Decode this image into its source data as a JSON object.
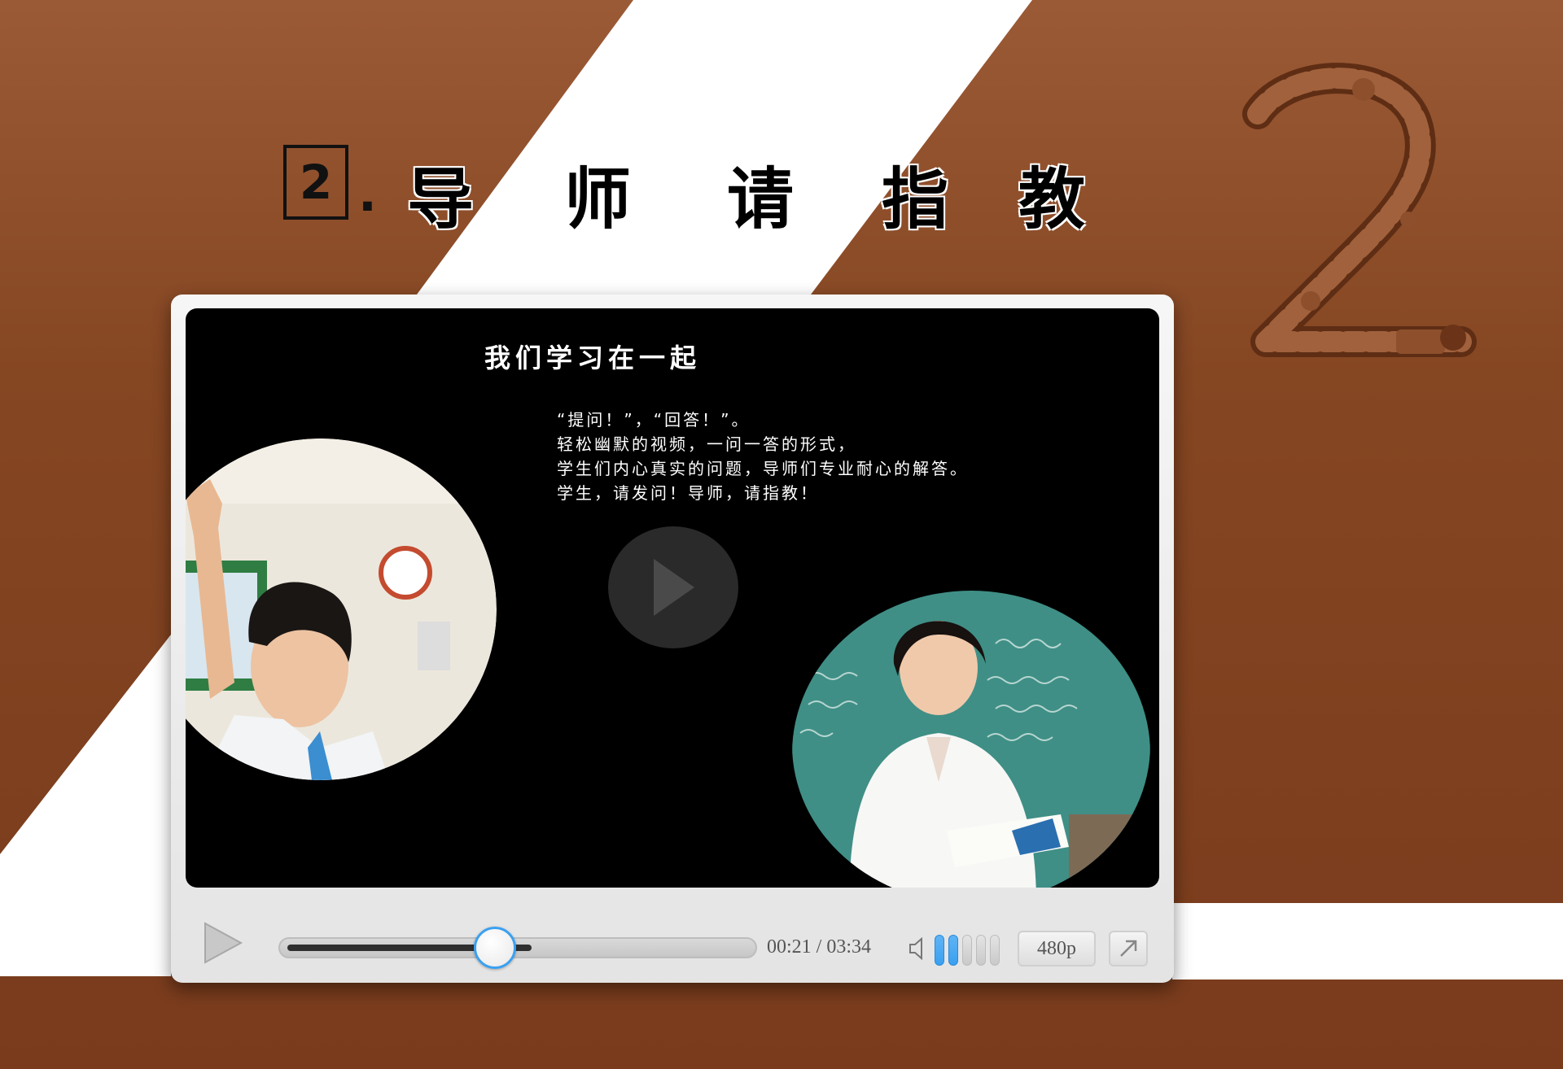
{
  "heading": {
    "number": "2",
    "dot": ".",
    "chars": [
      "导",
      "师",
      "请",
      "指",
      "教"
    ]
  },
  "decor": {
    "big_numeral_icon": "numeral-two-collage-icon"
  },
  "video": {
    "title": "我们学习在一起",
    "lines": [
      "“提问！”，“回答！”。",
      "轻松幽默的视频，一问一答的形式，",
      "学生们内心真实的问题，导师们专业耐心的解答。",
      "学生，请发问！导师，请指教！"
    ],
    "play_icon": "play-icon"
  },
  "controls": {
    "current_time": "00:21",
    "separator": "/",
    "total_time": "03:34",
    "progress": 0.45,
    "buffered": 0.53,
    "volume_level": 2,
    "volume_max": 5,
    "resolution": "480p",
    "fullscreen_icon": "expand-arrow-icon"
  },
  "colors": {
    "brown": "#7a3d1e",
    "accent": "#3aa0f0"
  }
}
